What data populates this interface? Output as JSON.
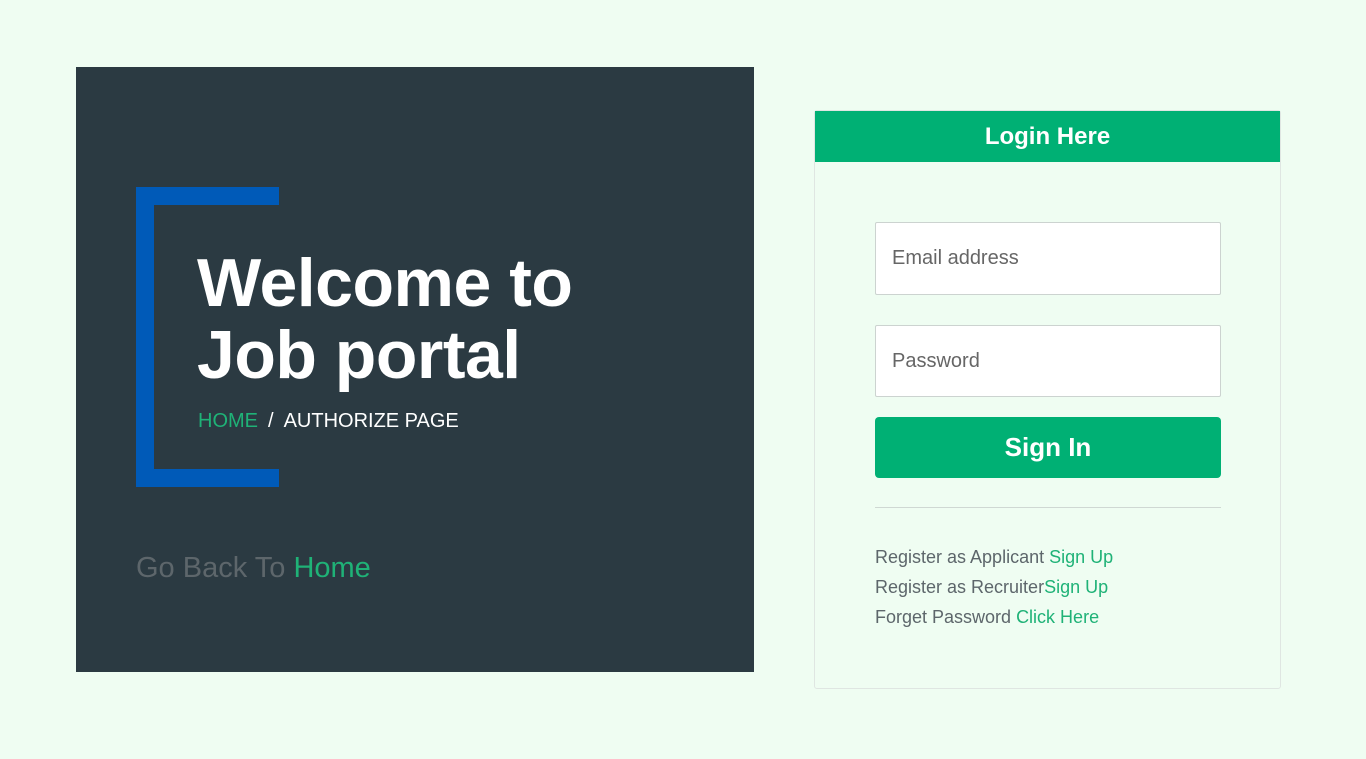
{
  "hero": {
    "title_line1": "Welcome to",
    "title_line2": "Job portal",
    "breadcrumb_home": "HOME",
    "breadcrumb_sep": "/",
    "breadcrumb_current": "AUTHORIZE PAGE",
    "goback_text": "Go Back To",
    "goback_link": "Home"
  },
  "login": {
    "header": "Login Here",
    "email_placeholder": "Email address",
    "password_placeholder": "Password",
    "signin_label": "Sign In",
    "links": [
      {
        "text": "Register as Applicant ",
        "link": "Sign Up"
      },
      {
        "text": "Register as Recruiter",
        "link": "Sign Up"
      },
      {
        "text": "Forget Password ",
        "link": "Click Here"
      }
    ]
  },
  "colors": {
    "background": "#effdf2",
    "hero_bg": "#2b3a42",
    "accent_green": "#00b074",
    "bracket_blue": "#005ab8"
  }
}
